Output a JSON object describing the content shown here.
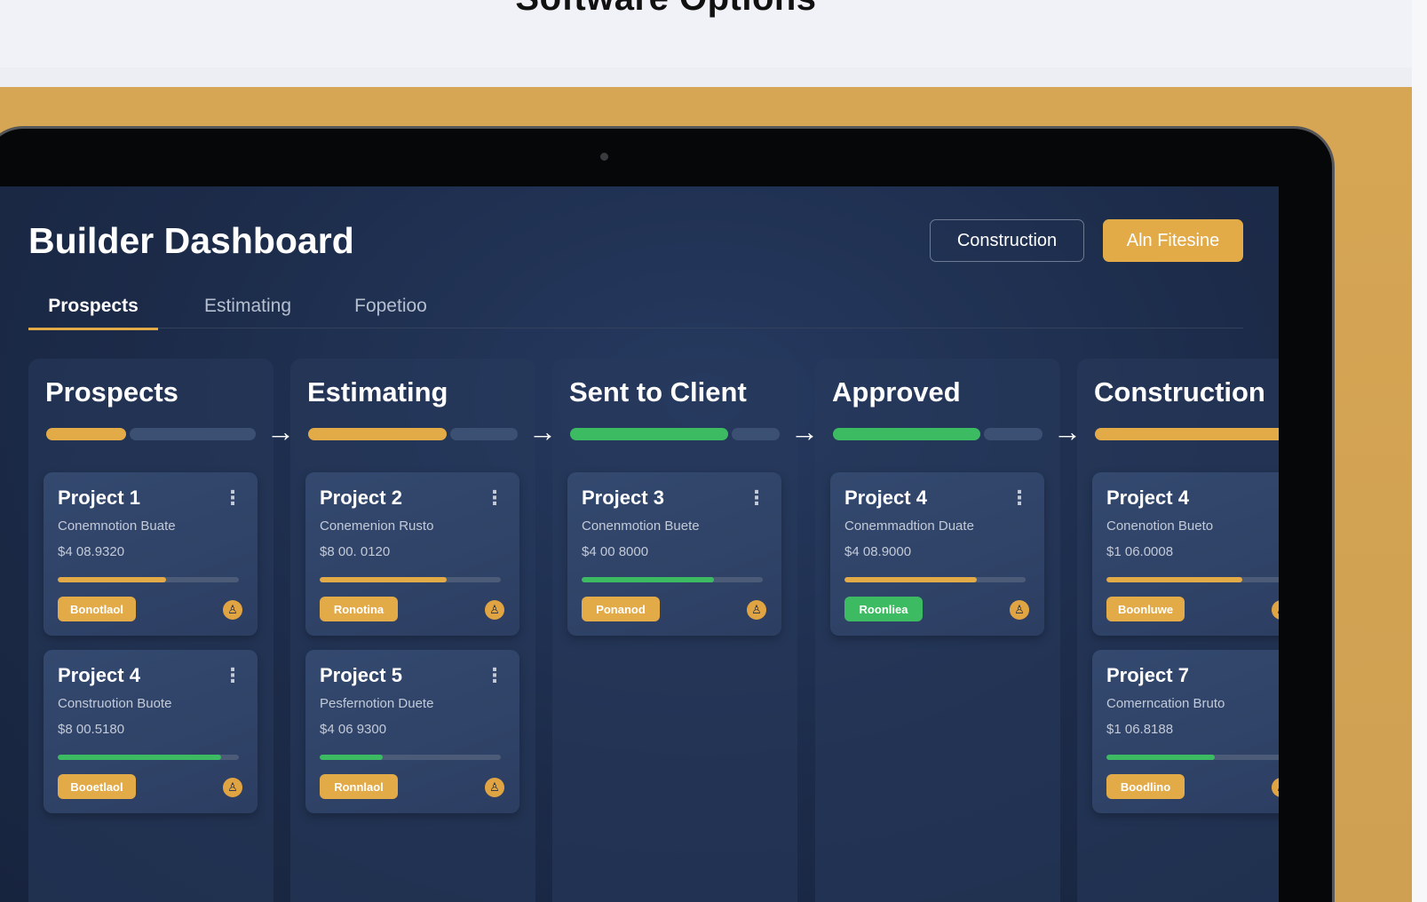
{
  "page": {
    "title": "Software Options"
  },
  "dashboard": {
    "title": "Builder Dashboard",
    "buttons": {
      "secondary": "Construction",
      "primary": "Aln Fitesine"
    },
    "tabs": [
      {
        "label": "Prospects",
        "active": true
      },
      {
        "label": "Estimating",
        "active": false
      },
      {
        "label": "Fopetioo",
        "active": false
      }
    ]
  },
  "colors": {
    "accent": "#e3aa48",
    "success": "#3dbb62",
    "background": "#1c2b49"
  },
  "columns": [
    {
      "title": "Prospects",
      "stage_progress": 0.4,
      "stage_color": "#e3aa48",
      "cards": [
        {
          "title": "Project 1",
          "subtitle": "Conemnotion Buate",
          "amount": "$4 08.9320",
          "progress": 0.6,
          "progress_color": "#e3aa48",
          "badge": "Bonotlaol",
          "badge_color": "#e3aa48"
        },
        {
          "title": "Project 4",
          "subtitle": "Construotion Buote",
          "amount": "$8 00.5180",
          "progress": 0.9,
          "progress_color": "#3dbb62",
          "badge": "Booetlaol",
          "badge_color": "#e3aa48"
        }
      ]
    },
    {
      "title": "Estimating",
      "stage_progress": 0.68,
      "stage_color": "#e3aa48",
      "cards": [
        {
          "title": "Project 2",
          "subtitle": "Conemenion Rusto",
          "amount": "$8 00. 0120",
          "progress": 0.7,
          "progress_color": "#e3aa48",
          "badge": "Ronotina",
          "badge_color": "#e3aa48"
        },
        {
          "title": "Project 5",
          "subtitle": "Pesfernotion Duete",
          "amount": "$4 06 9300",
          "progress": 0.35,
          "progress_color": "#3dbb62",
          "badge": "Ronnlaol",
          "badge_color": "#e3aa48"
        }
      ]
    },
    {
      "title": "Sent to Client",
      "stage_progress": 0.77,
      "stage_color": "#3dbb62",
      "cards": [
        {
          "title": "Project 3",
          "subtitle": "Conenmotion Buete",
          "amount": "$4 00 8000",
          "progress": 0.73,
          "progress_color": "#3dbb62",
          "badge": "Ponanod",
          "badge_color": "#e3aa48"
        }
      ]
    },
    {
      "title": "Approved",
      "stage_progress": 0.72,
      "stage_color": "#3dbb62",
      "cards": [
        {
          "title": "Project 4",
          "subtitle": "Conemmadtion Duate",
          "amount": "$4 08.9000",
          "progress": 0.73,
          "progress_color": "#e3aa48",
          "badge": "Roonliea",
          "badge_color": "#3dbb62"
        }
      ]
    },
    {
      "title": "Construction",
      "stage_progress": 1.0,
      "stage_color": "#e3aa48",
      "cards": [
        {
          "title": "Project 4",
          "subtitle": "Conenotion Bueto",
          "amount": "$1 06.0008",
          "progress": 0.75,
          "progress_color": "#e3aa48",
          "badge": "Boonluwe",
          "badge_color": "#e3aa48"
        },
        {
          "title": "Project 7",
          "subtitle": "Comerncation Bruto",
          "amount": "$1 06.8188",
          "progress": 0.6,
          "progress_color": "#3dbb62",
          "badge": "Boodlino",
          "badge_color": "#e3aa48"
        }
      ]
    }
  ],
  "icons": {
    "arrow": "arrow-right-icon",
    "kebab": "more-vertical-icon",
    "avatar": "user-avatar-icon"
  }
}
